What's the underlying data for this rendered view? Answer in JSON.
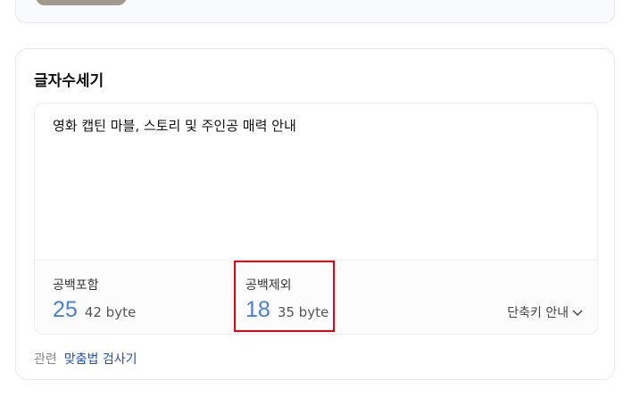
{
  "counter": {
    "title": "글자수세기",
    "text": "영화 캡틴 마블, 스토리 및 주인공 매력 안내",
    "with_spaces": {
      "label": "공백포함",
      "count": "25",
      "bytes": "42 byte"
    },
    "without_spaces": {
      "label": "공백제외",
      "count": "18",
      "bytes": "35 byte"
    },
    "shortcut_label": "단축키 안내",
    "accent_color": "#4a7fe0",
    "highlight_color": "#e60012"
  },
  "related": {
    "label": "관련",
    "link": "맞춤법 검사기"
  },
  "icons": {
    "shortcut_chevron": "chevron-down-icon"
  }
}
